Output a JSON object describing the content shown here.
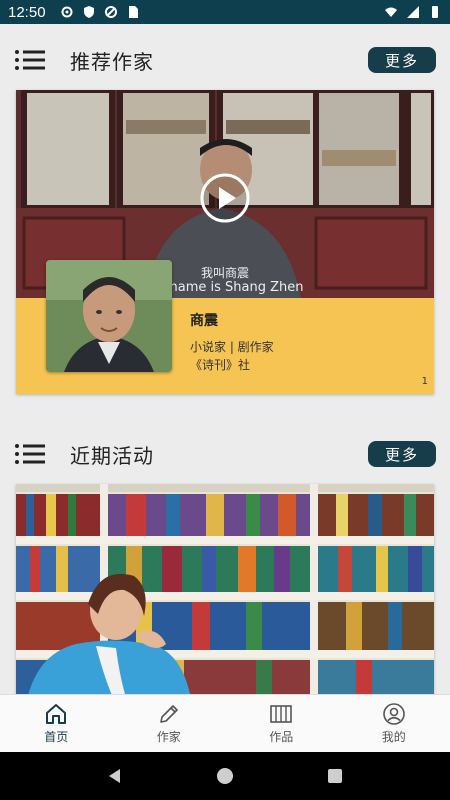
{
  "status_bar": {
    "time": "12:50"
  },
  "sections": {
    "writers": {
      "title": "推荐作家",
      "more_label": "更多"
    },
    "events": {
      "title": "近期活动",
      "more_label": "更多"
    }
  },
  "writer_card": {
    "subtitle_cn": "我叫商震",
    "subtitle_en": "My name is Shang Zhen",
    "name": "商震",
    "roles": "小说家 | 剧作家",
    "organization": "《诗刊》社",
    "page_index": "1"
  },
  "bottom_nav": {
    "items": [
      {
        "label": "首页",
        "icon": "home-icon"
      },
      {
        "label": "作家",
        "icon": "pencil-icon"
      },
      {
        "label": "作品",
        "icon": "books-icon"
      },
      {
        "label": "我的",
        "icon": "user-icon"
      }
    ]
  },
  "colors": {
    "accent": "#173c4a",
    "status_bar": "#0d3f4e",
    "info_panel": "#f5c452"
  }
}
